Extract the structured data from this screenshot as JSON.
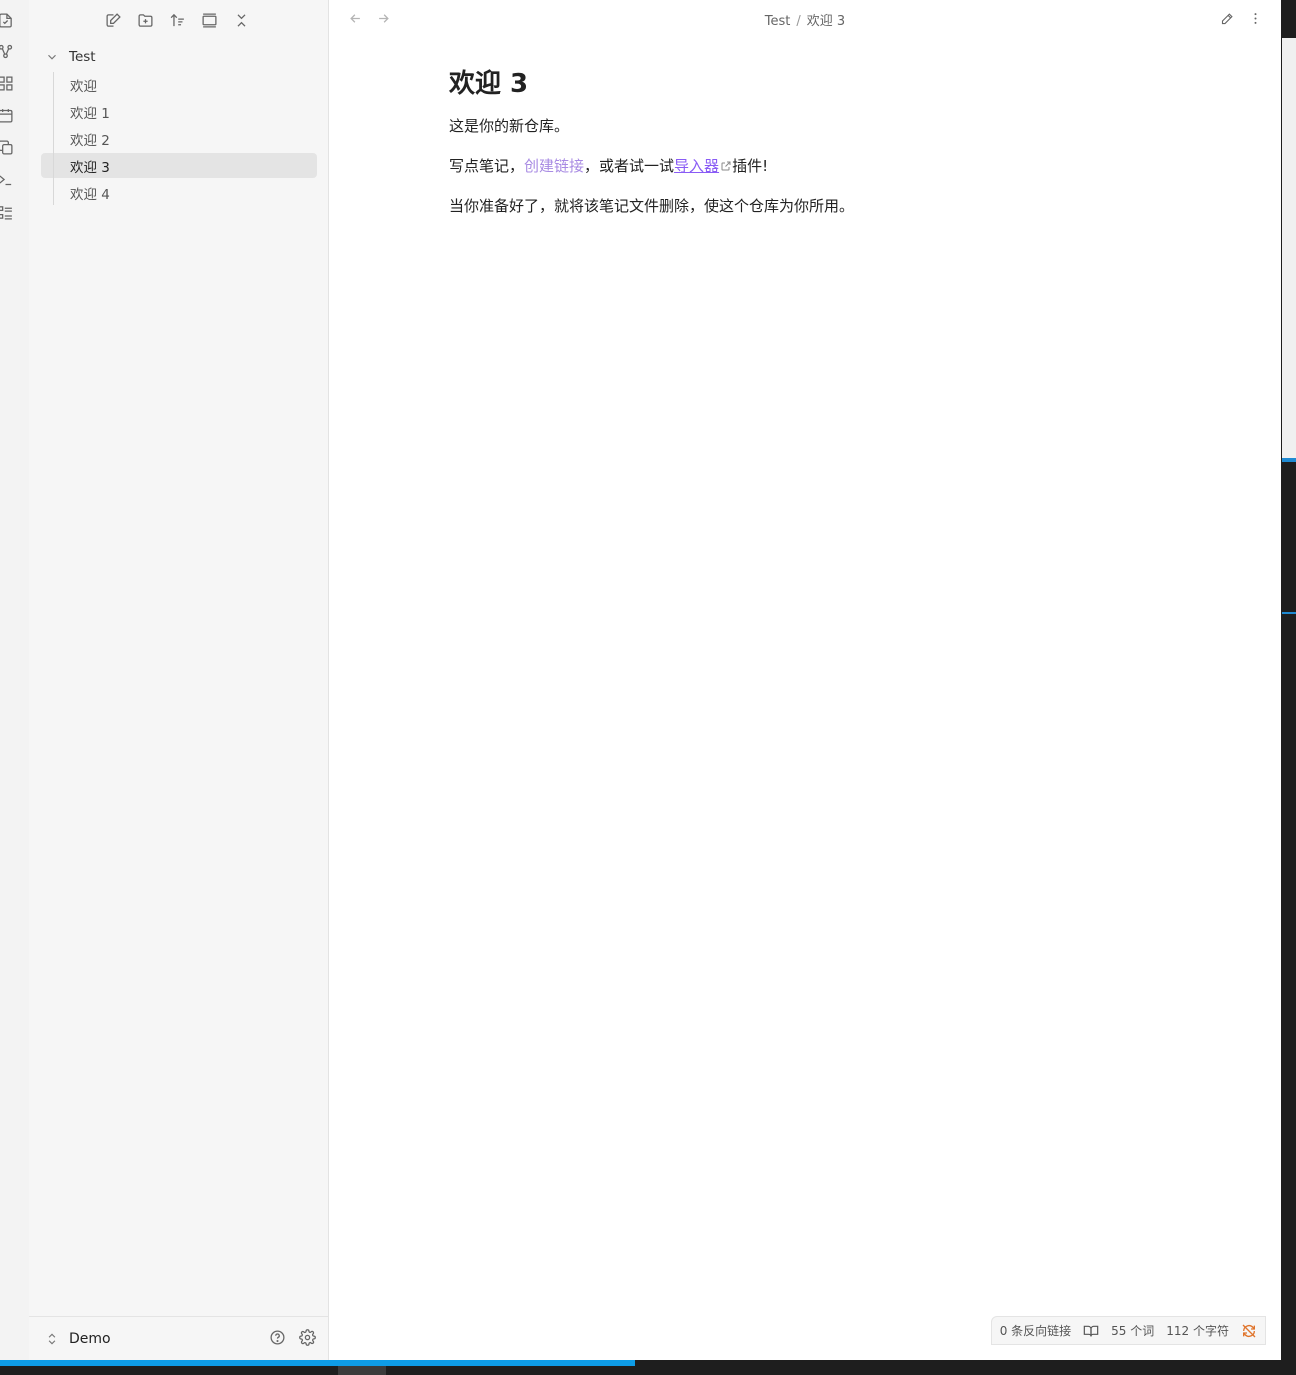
{
  "ribbon": {
    "icons": [
      "files-icon",
      "graph-icon",
      "canvas-icon",
      "calendar-icon",
      "copy-icon",
      "terminal-icon",
      "outline-icon"
    ]
  },
  "sidebar": {
    "toolbar": [
      "new-note-icon",
      "new-folder-icon",
      "sort-icon",
      "collapse-all-icon",
      "close-icon"
    ],
    "folder": {
      "name": "Test",
      "files": [
        {
          "name": "欢迎",
          "active": false
        },
        {
          "name": "欢迎 1",
          "active": false
        },
        {
          "name": "欢迎 2",
          "active": false
        },
        {
          "name": "欢迎 3",
          "active": true
        },
        {
          "name": "欢迎 4",
          "active": false
        }
      ]
    },
    "vault": {
      "name": "Demo"
    }
  },
  "header": {
    "breadcrumb_parent": "Test",
    "breadcrumb_separator": "/",
    "breadcrumb_current": "欢迎 3"
  },
  "note": {
    "title": "欢迎 3",
    "p1": "这是你的新仓库。",
    "p2_before": "写点笔记，",
    "p2_link_internal": "创建链接",
    "p2_middle": "，或者试一试",
    "p2_link_external": "导入器",
    "p2_after": "插件!",
    "p3": "当你准备好了，就将该笔记文件删除，使这个仓库为你所用。"
  },
  "status": {
    "backlinks": "0 条反向链接",
    "words": "55 个词",
    "chars": "112 个字符"
  },
  "progress": {
    "fraction": 0.49
  },
  "colors": {
    "accent": "#8a5cf5",
    "internal_link": "#a88be3",
    "progress": "#0e9ce6",
    "sync_warning": "#e0752d"
  }
}
